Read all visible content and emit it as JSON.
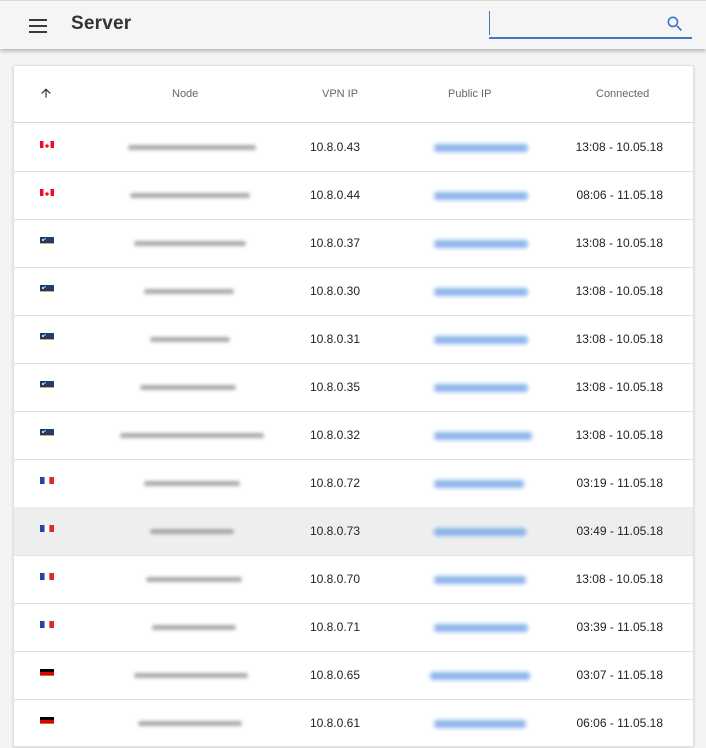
{
  "app": {
    "title": "Server"
  },
  "search": {
    "placeholder": "",
    "value": ""
  },
  "table": {
    "columns": [
      "Node",
      "VPN IP",
      "Public IP",
      "Connected"
    ],
    "rows": [
      {
        "flag": "ca",
        "node": "",
        "vpn_ip": "10.8.0.43",
        "public_ip": "",
        "connected": "13:08 - 10.05.18"
      },
      {
        "flag": "ca",
        "node": "",
        "vpn_ip": "10.8.0.44",
        "public_ip": "",
        "connected": "08:06 - 11.05.18"
      },
      {
        "flag": "cw",
        "node": "",
        "vpn_ip": "10.8.0.37",
        "public_ip": "",
        "connected": "13:08 - 10.05.18"
      },
      {
        "flag": "cw",
        "node": "",
        "vpn_ip": "10.8.0.30",
        "public_ip": "",
        "connected": "13:08 - 10.05.18"
      },
      {
        "flag": "cw",
        "node": "",
        "vpn_ip": "10.8.0.31",
        "public_ip": "",
        "connected": "13:08 - 10.05.18"
      },
      {
        "flag": "cw",
        "node": "",
        "vpn_ip": "10.8.0.35",
        "public_ip": "",
        "connected": "13:08 - 10.05.18"
      },
      {
        "flag": "cw",
        "node": "",
        "vpn_ip": "10.8.0.32",
        "public_ip": "",
        "connected": "13:08 - 10.05.18"
      },
      {
        "flag": "fr",
        "node": "",
        "vpn_ip": "10.8.0.72",
        "public_ip": "",
        "connected": "03:19 - 11.05.18"
      },
      {
        "flag": "fr",
        "node": "",
        "vpn_ip": "10.8.0.73",
        "public_ip": "",
        "connected": "03:49 - 11.05.18",
        "selected": true
      },
      {
        "flag": "fr",
        "node": "",
        "vpn_ip": "10.8.0.70",
        "public_ip": "",
        "connected": "13:08 - 10.05.18"
      },
      {
        "flag": "fr",
        "node": "",
        "vpn_ip": "10.8.0.71",
        "public_ip": "",
        "connected": "03:39 - 11.05.18"
      },
      {
        "flag": "de",
        "node": "",
        "vpn_ip": "10.8.0.65",
        "public_ip": "",
        "connected": "03:07 - 11.05.18"
      },
      {
        "flag": "de",
        "node": "",
        "vpn_ip": "10.8.0.61",
        "public_ip": "",
        "connected": "06:06 - 11.05.18"
      }
    ]
  },
  "colors": {
    "accent": "#3f76c8",
    "selected_row": "#eeeeee"
  },
  "icons": {
    "menu": "menu-icon",
    "search": "search-icon",
    "sort": "arrow-up-icon"
  }
}
